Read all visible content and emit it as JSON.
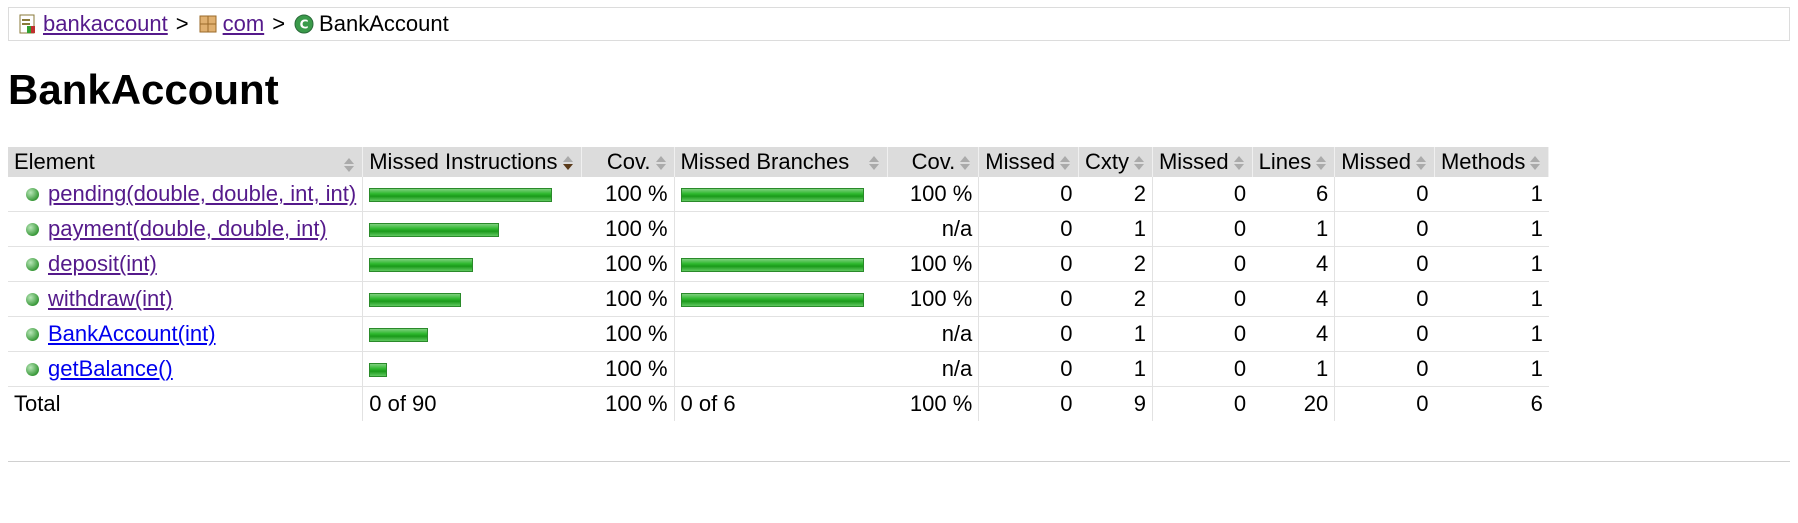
{
  "breadcrumb": {
    "items": [
      {
        "label": "bankaccount",
        "icon": "report-icon"
      },
      {
        "label": "com",
        "icon": "package-icon"
      },
      {
        "label": "BankAccount",
        "icon": "class-icon"
      }
    ],
    "separator": ">"
  },
  "page_title": "BankAccount",
  "table": {
    "headers": [
      "Element",
      "Missed Instructions",
      "Cov.",
      "Missed Branches",
      "Cov.",
      "Missed",
      "Cxty",
      "Missed",
      "Lines",
      "Missed",
      "Methods"
    ],
    "rows": [
      {
        "name": "pending(double, double, int, int)",
        "instr_fill": 1.0,
        "instr_cov": "100 %",
        "branch_fill": 1.0,
        "branch_cov": "100 %",
        "missed_cxty": "0",
        "cxty": "2",
        "missed_lines": "0",
        "lines": "6",
        "missed_methods": "0",
        "methods": "1",
        "visited": true
      },
      {
        "name": "payment(double, double, int)",
        "instr_fill": 0.71,
        "instr_cov": "100 %",
        "branch_fill": 0,
        "branch_cov": "n/a",
        "missed_cxty": "0",
        "cxty": "1",
        "missed_lines": "0",
        "lines": "1",
        "missed_methods": "0",
        "methods": "1",
        "visited": true
      },
      {
        "name": "deposit(int)",
        "instr_fill": 0.57,
        "instr_cov": "100 %",
        "branch_fill": 1.0,
        "branch_cov": "100 %",
        "missed_cxty": "0",
        "cxty": "2",
        "missed_lines": "0",
        "lines": "4",
        "missed_methods": "0",
        "methods": "1",
        "visited": true
      },
      {
        "name": "withdraw(int)",
        "instr_fill": 0.5,
        "instr_cov": "100 %",
        "branch_fill": 1.0,
        "branch_cov": "100 %",
        "missed_cxty": "0",
        "cxty": "2",
        "missed_lines": "0",
        "lines": "4",
        "missed_methods": "0",
        "methods": "1",
        "visited": true
      },
      {
        "name": "BankAccount(int)",
        "instr_fill": 0.32,
        "instr_cov": "100 %",
        "branch_fill": 0,
        "branch_cov": "n/a",
        "missed_cxty": "0",
        "cxty": "1",
        "missed_lines": "0",
        "lines": "4",
        "missed_methods": "0",
        "methods": "1",
        "visited": false
      },
      {
        "name": "getBalance()",
        "instr_fill": 0.1,
        "instr_cov": "100 %",
        "branch_fill": 0,
        "branch_cov": "n/a",
        "missed_cxty": "0",
        "cxty": "1",
        "missed_lines": "0",
        "lines": "1",
        "missed_methods": "0",
        "methods": "1",
        "visited": false
      }
    ],
    "total": {
      "label": "Total",
      "instr": "0 of 90",
      "instr_cov": "100 %",
      "branch": "0 of 6",
      "branch_cov": "100 %",
      "missed_cxty": "0",
      "cxty": "9",
      "missed_lines": "0",
      "lines": "20",
      "missed_methods": "0",
      "methods": "6"
    }
  },
  "colors": {
    "bar_green": "#2db82d",
    "header_bg": "#dcdcdc",
    "visited_link": "#551a8b",
    "link": "#0000ee"
  }
}
